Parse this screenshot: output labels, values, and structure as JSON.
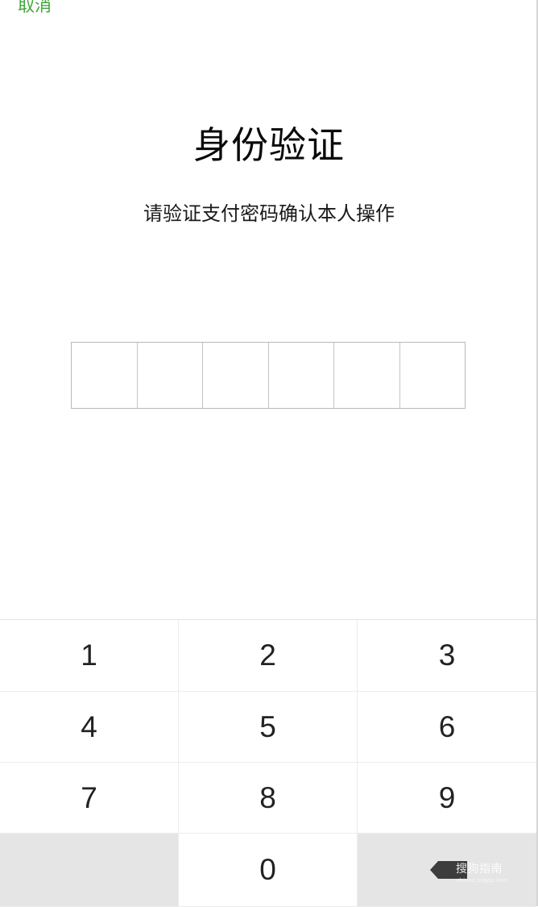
{
  "header": {
    "cancel_label": "取消"
  },
  "main": {
    "title": "身份验证",
    "subtitle": "请验证支付密码确认本人操作"
  },
  "pin": {
    "length": 6,
    "entered_count": 0
  },
  "keypad": {
    "keys": [
      "1",
      "2",
      "3",
      "4",
      "5",
      "6",
      "7",
      "8",
      "9",
      "",
      "0",
      "backspace"
    ]
  },
  "watermark": {
    "text": "搜狗指南",
    "sub": "zhinan.sogou.com"
  },
  "colors": {
    "accent": "#3fa53a",
    "keypad_gray": "#e5e5e5"
  },
  "icons": {
    "backspace": "backspace-icon",
    "watermark_logo": "sogou-logo-icon"
  }
}
